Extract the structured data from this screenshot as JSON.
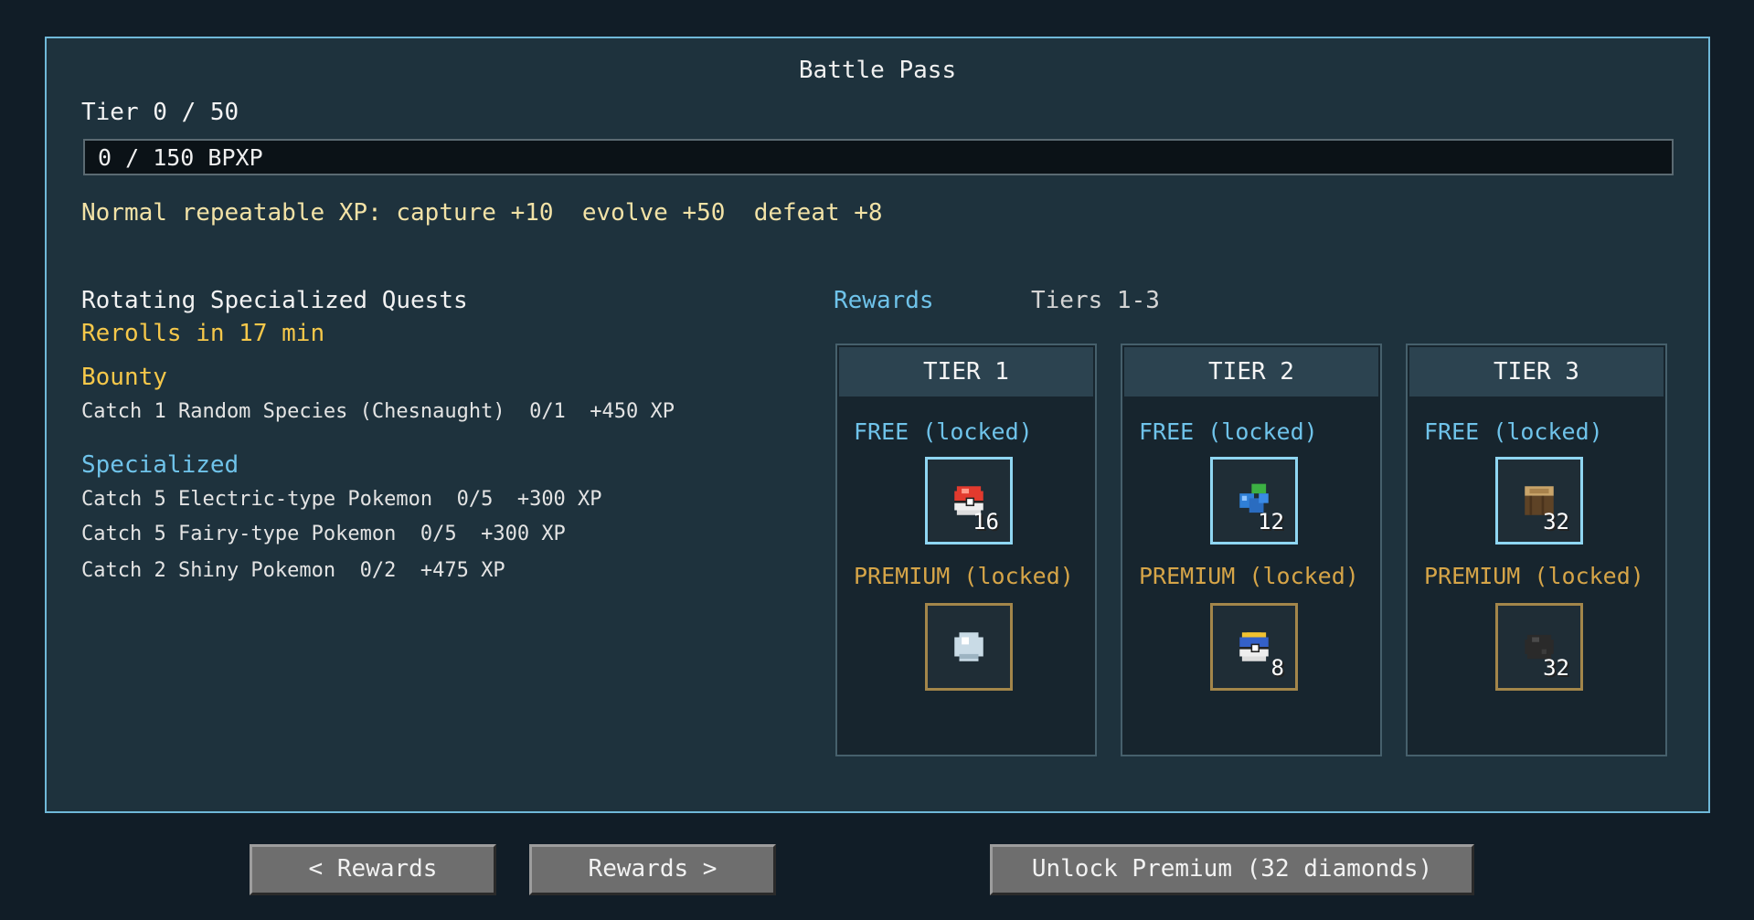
{
  "title": "Battle Pass",
  "tier_label": "Tier 0 / 50",
  "xp_bar": {
    "text": "0 / 150 BPXP",
    "progress": 0
  },
  "repeatable_xp": "Normal repeatable XP: capture +10  evolve +50  defeat +8",
  "quests": {
    "title": "Rotating Specialized Quests",
    "rerolls": "Rerolls in 17 min",
    "bounty_title": "Bounty",
    "bounty": "Catch 1 Random Species (Chesnaught)  0/1  +450 XP",
    "specialized_title": "Specialized",
    "specialized": [
      "Catch 5 Electric-type Pokemon  0/5  +300 XP",
      "Catch 5 Fairy-type Pokemon  0/5  +300 XP",
      "Catch 2 Shiny Pokemon  0/2  +475 XP"
    ]
  },
  "rewards": {
    "label": "Rewards",
    "range": "Tiers 1-3",
    "tiers": [
      {
        "header": "TIER 1",
        "free_label": "FREE (locked)",
        "free_item": {
          "icon": "poke-ball-icon",
          "count": "16"
        },
        "premium_label": "PREMIUM (locked)",
        "premium_item": {
          "icon": "white-orb-icon",
          "count": ""
        }
      },
      {
        "header": "TIER 2",
        "free_label": "FREE (locked)",
        "free_item": {
          "icon": "berry-cluster-icon",
          "count": "12"
        },
        "premium_label": "PREMIUM (locked)",
        "premium_item": {
          "icon": "ultra-ball-icon",
          "count": "8"
        }
      },
      {
        "header": "TIER 3",
        "free_label": "FREE (locked)",
        "free_item": {
          "icon": "wood-log-icon",
          "count": "32"
        },
        "premium_label": "PREMIUM (locked)",
        "premium_item": {
          "icon": "coal-icon",
          "count": "32"
        }
      }
    ]
  },
  "buttons": {
    "prev": "< Rewards",
    "next": "Rewards >",
    "unlock": "Unlock Premium (32 diamonds)"
  }
}
